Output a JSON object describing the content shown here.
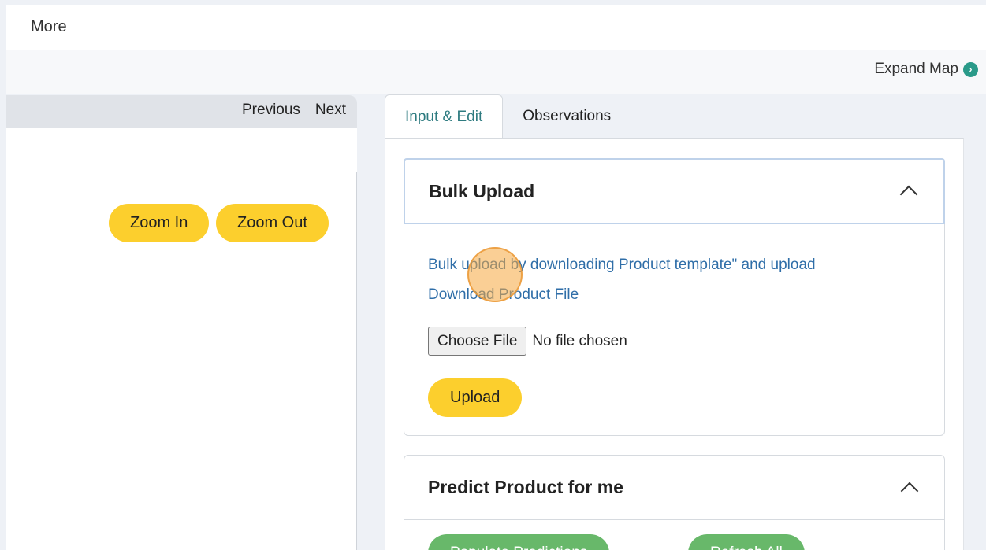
{
  "header": {
    "more_label": "More"
  },
  "map": {
    "expand_label": "Expand Map",
    "expand_icon": "chevron-right-circle-icon"
  },
  "left_panel": {
    "previous_label": "Previous",
    "next_label": "Next",
    "zoom_in_label": "Zoom In",
    "zoom_out_label": "Zoom Out"
  },
  "tabs": [
    {
      "label": "Input & Edit",
      "active": true
    },
    {
      "label": "Observations",
      "active": false
    }
  ],
  "bulk_upload": {
    "title": "Bulk Upload",
    "instruction_link": "Bulk upload by downloading Product template\" and upload",
    "download_link": "Download Product File",
    "choose_file_label": "Choose File",
    "file_status": "No file chosen",
    "upload_label": "Upload"
  },
  "predict": {
    "title": "Predict Product for me",
    "button1_label": "Populate Predictions",
    "button2_label": "Refresh All"
  },
  "colors": {
    "accent_yellow": "#fccf2d",
    "tab_active_text": "#2e7b80",
    "link_blue": "#2f6ea8",
    "green_button": "#68b86a"
  }
}
